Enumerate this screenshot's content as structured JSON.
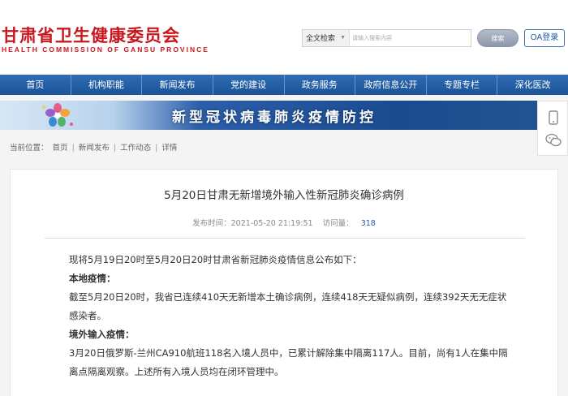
{
  "header": {
    "logo_cn": "甘肃省卫生健康委员会",
    "logo_en": "HEALTH COMMISSION OF GANSU PROVINCE",
    "search_scope": "全文检索",
    "search_placeholder": "请输入搜索内容",
    "search_button": "搜索",
    "oa_login": "OA登录"
  },
  "nav": [
    {
      "label": "首页"
    },
    {
      "label": "机构职能"
    },
    {
      "label": "新闻发布"
    },
    {
      "label": "党的建设"
    },
    {
      "label": "政务服务"
    },
    {
      "label": "政府信息公开"
    },
    {
      "label": "专题专栏"
    },
    {
      "label": "深化医改"
    }
  ],
  "banner": {
    "title": "新型冠状病毒肺炎疫情防控"
  },
  "side_icons": [
    {
      "icon": "mobile-icon"
    },
    {
      "icon": "wechat-icon"
    }
  ],
  "breadcrumb": {
    "prefix": "当前位置：",
    "items": [
      "首页",
      "新闻发布",
      "工作动态",
      "详情"
    ],
    "separator": "|"
  },
  "article": {
    "title": "5月20日甘肃无新增境外输入性新冠肺炎确诊病例",
    "publish_label": "发布时间：",
    "publish_time": "2021-05-20 21:19:51",
    "views_label": "访问量：",
    "views": "318",
    "intro": "现将5月19日20时至5月20日20时甘肃省新冠肺炎疫情信息公布如下：",
    "local_heading": "本地疫情：",
    "local_text_line1": "截至5月20日20时，我省已连续410天无新增本土确诊病例，连续418天无疑似病例，连续392天无无症状",
    "local_text_line2": "感染者。",
    "import_heading": "境外输入疫情：",
    "import_text_line1": "3月20日俄罗斯-兰州CA910航班118名入境人员中，已累计解除集中隔离117人。目前，尚有1人在集中隔",
    "import_text_line2": "离点隔离观察。上述所有入境人员均在闭环管理中。"
  },
  "colors": {
    "brand_red": "#c9171e",
    "nav_blue": "#1c5299",
    "link_blue": "#1f5aa8"
  }
}
